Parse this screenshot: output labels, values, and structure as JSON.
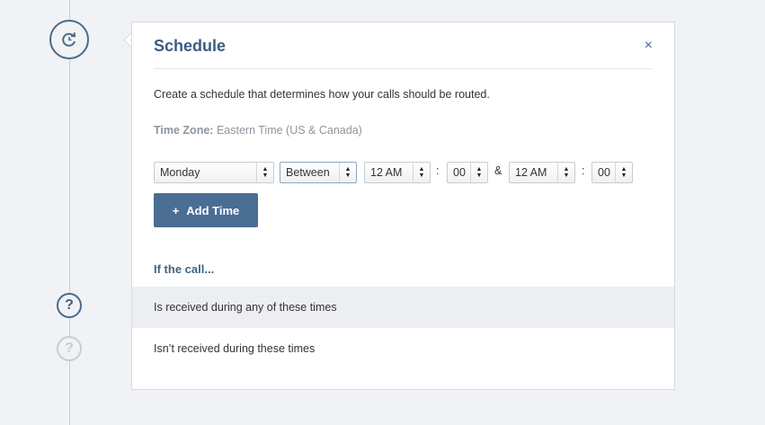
{
  "panel": {
    "title": "Schedule",
    "close_label": "×",
    "description": "Create a schedule that determines how your calls should be routed.",
    "timezone_label": "Time Zone:",
    "timezone_value": "Eastern Time (US & Canada)"
  },
  "schedule_row": {
    "day": "Monday",
    "condition": "Between",
    "start_hour": "12 AM",
    "start_minute": "00",
    "time_separator": ":",
    "range_separator": "&",
    "end_hour": "12 AM",
    "end_minute": "00"
  },
  "add_time": {
    "icon": "+",
    "label": "Add Time"
  },
  "condition_section": {
    "heading": "If the call...",
    "options": [
      {
        "label": "Is received during any of these times",
        "selected": true
      },
      {
        "label": "Isn’t received during these times",
        "selected": false
      }
    ]
  },
  "timeline": {
    "help_glyph": "?",
    "help_glyph_faded": "?"
  },
  "colors": {
    "accent": "#4a6d93",
    "title": "#3c5c7e",
    "selected_row": "#eceef1"
  }
}
